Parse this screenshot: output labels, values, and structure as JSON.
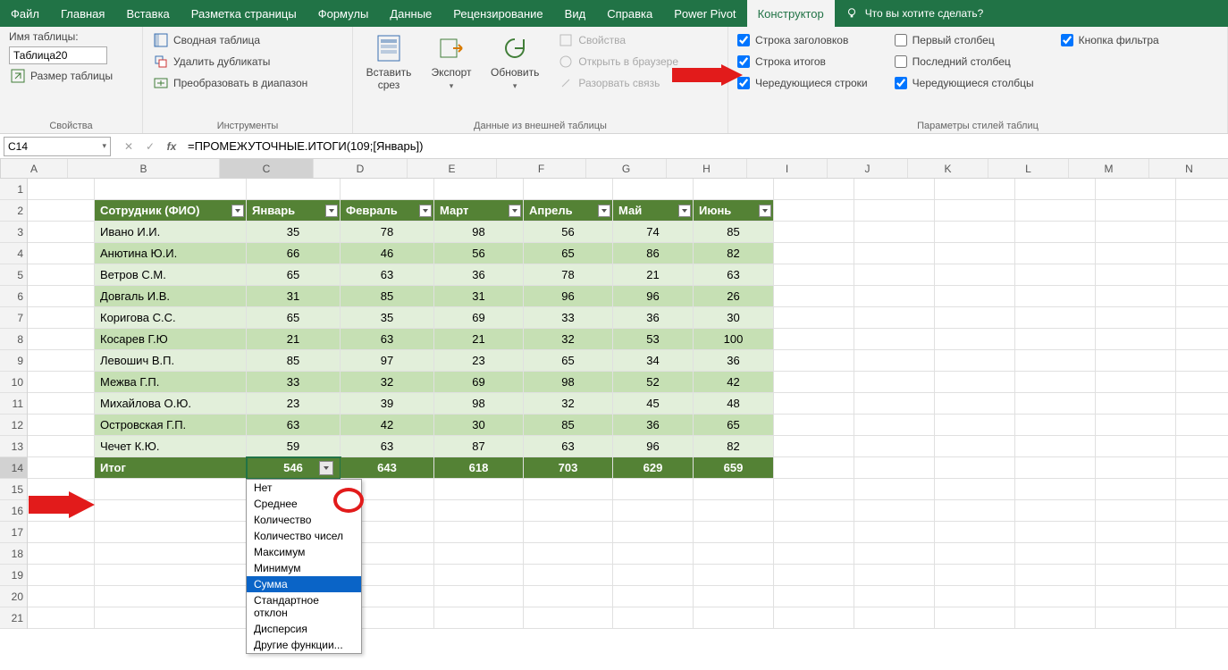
{
  "tabs": [
    "Файл",
    "Главная",
    "Вставка",
    "Разметка страницы",
    "Формулы",
    "Данные",
    "Рецензирование",
    "Вид",
    "Справка",
    "Power Pivot",
    "Конструктор"
  ],
  "active_tab": 10,
  "tellme": "Что вы хотите сделать?",
  "ribbon": {
    "props": {
      "title_label": "Имя таблицы:",
      "table_name": "Таблица20",
      "resize": "Размер таблицы",
      "group": "Свойства"
    },
    "tools": {
      "pivot": "Сводная таблица",
      "dedup": "Удалить дубликаты",
      "convert": "Преобразовать в диапазон",
      "group": "Инструменты"
    },
    "slicer": {
      "label": "Вставить\nсрез"
    },
    "export": {
      "label": "Экспорт"
    },
    "refresh": {
      "label": "Обновить"
    },
    "ext": {
      "props": "Свойства",
      "open": "Открыть в браузере",
      "unlink": "Разорвать связь",
      "group": "Данные из внешней таблицы"
    },
    "styleopts": {
      "header": "Строка заголовков",
      "total": "Строка итогов",
      "banded_rows": "Чередующиеся строки",
      "first_col": "Первый столбец",
      "last_col": "Последний столбец",
      "banded_cols": "Чередующиеся столбцы",
      "filter_btn": "Кнопка фильтра",
      "group": "Параметры стилей таблиц"
    }
  },
  "namebox": "C14",
  "formula": "=ПРОМЕЖУТОЧНЫЕ.ИТОГИ(109;[Январь])",
  "columns": [
    "A",
    "B",
    "C",
    "D",
    "E",
    "F",
    "G",
    "H",
    "I",
    "J",
    "K",
    "L",
    "M",
    "N"
  ],
  "table": {
    "headers": [
      "Сотрудник (ФИО)",
      "Январь",
      "Февраль",
      "Март",
      "Апрель",
      "Май",
      "Июнь"
    ],
    "rows": [
      [
        "Ивано И.И.",
        35,
        78,
        98,
        56,
        74,
        85
      ],
      [
        "Анютина Ю.И.",
        66,
        46,
        56,
        65,
        86,
        82
      ],
      [
        "Ветров С.М.",
        65,
        63,
        36,
        78,
        21,
        63
      ],
      [
        "Довгаль И.В.",
        31,
        85,
        31,
        96,
        96,
        26
      ],
      [
        "Коригова С.С.",
        65,
        35,
        69,
        33,
        36,
        30
      ],
      [
        "Косарев Г.Ю",
        21,
        63,
        21,
        32,
        53,
        100
      ],
      [
        "Левошич В.П.",
        85,
        97,
        23,
        65,
        34,
        36
      ],
      [
        "Межва Г.П.",
        33,
        32,
        69,
        98,
        52,
        42
      ],
      [
        "Михайлова О.Ю.",
        23,
        39,
        98,
        32,
        45,
        48
      ],
      [
        "Островская Г.П.",
        63,
        42,
        30,
        85,
        36,
        65
      ],
      [
        "Чечет К.Ю.",
        59,
        63,
        87,
        63,
        96,
        82
      ]
    ],
    "total_label": "Итог",
    "totals": [
      546,
      643,
      618,
      703,
      629,
      659
    ]
  },
  "popup_items": [
    "Нет",
    "Среднее",
    "Количество",
    "Количество чисел",
    "Максимум",
    "Минимум",
    "Сумма",
    "Стандартное отклон",
    "Дисперсия",
    "Другие функции..."
  ],
  "popup_selected": 6
}
